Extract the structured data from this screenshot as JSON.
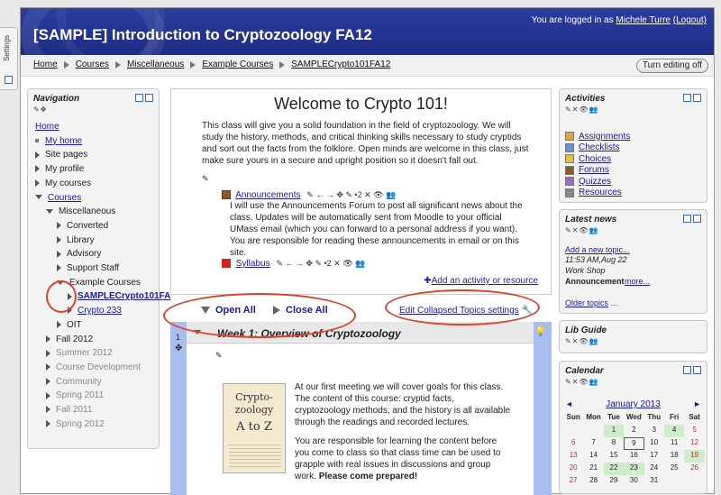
{
  "settings_tab": {
    "label": "Settings"
  },
  "header": {
    "site_title": "[SAMPLE] Introduction to Cryptozoology FA12",
    "login_prefix": "You are logged in as",
    "user_name": "Michele Turre",
    "logout": "(Logout)"
  },
  "breadcrumb": [
    "Home",
    "Courses",
    "Miscellaneous",
    "Example Courses",
    "SAMPLECrypto101FA12"
  ],
  "turn_editing_off": "Turn editing off",
  "navigation": {
    "title": "Navigation",
    "items": [
      {
        "label": "Home",
        "type": "link",
        "depth": 0
      },
      {
        "label": "My home",
        "type": "bullet",
        "depth": 0
      },
      {
        "label": "Site pages",
        "type": "collapsed",
        "depth": 0
      },
      {
        "label": "My profile",
        "type": "collapsed",
        "depth": 0
      },
      {
        "label": "My courses",
        "type": "collapsed",
        "depth": 0
      },
      {
        "label": "Courses",
        "type": "expanded",
        "depth": 0
      },
      {
        "label": "Miscellaneous",
        "type": "expanded",
        "depth": 1
      },
      {
        "label": "Converted",
        "type": "collapsed",
        "depth": 2
      },
      {
        "label": "Library",
        "type": "collapsed",
        "depth": 2
      },
      {
        "label": "Advisory",
        "type": "collapsed",
        "depth": 2
      },
      {
        "label": "Support Staff",
        "type": "collapsed",
        "depth": 2
      },
      {
        "label": "Example Courses",
        "type": "expanded",
        "depth": 2
      },
      {
        "label": "SAMPLECrypto101FA",
        "type": "current",
        "depth": 3
      },
      {
        "label": "Crypto 233",
        "type": "collapsed",
        "depth": 3
      },
      {
        "label": "OIT",
        "type": "collapsed",
        "depth": 2
      },
      {
        "label": "Fall 2012",
        "type": "collapsed",
        "depth": 1
      },
      {
        "label": "Summer 2012",
        "type": "grey",
        "depth": 1
      },
      {
        "label": "Course Development",
        "type": "grey",
        "depth": 1
      },
      {
        "label": "Community",
        "type": "grey",
        "depth": 1
      },
      {
        "label": "Spring 2011",
        "type": "grey",
        "depth": 1
      },
      {
        "label": "Fall 2011",
        "type": "grey",
        "depth": 1
      },
      {
        "label": "Spring 2012",
        "type": "grey",
        "depth": 1
      }
    ]
  },
  "welcome": {
    "heading": "Welcome to Crypto 101!",
    "intro": "This class will give you a solid foundation in the field of cryptozoology. We will study the history, methods, and critical thinking skills necessary to study cryptids and sort out the facts from the folklore. Open minds are welcome in this class, just make sure yours in a secure and upright position so it doesn't fall out.",
    "announcements": "Announcements",
    "announcements_desc": "I will use the Announcements Forum to post all significant news about the class. Updates will be automatically sent from Moodle to your official UMass email (which you can forward to a personal address if you want). You are responsible for reading these announcements in email or on this site.",
    "syllabus": "Syllabus",
    "add_activity": "Add an activity or resource"
  },
  "controls": {
    "open_all": "Open All",
    "close_all": "Close All",
    "edit_collapsed": "Edit Collapsed Topics settings"
  },
  "week1": {
    "number": "1",
    "title": "Week 1: Overview of Cryptozoology",
    "p1": "At our first meeting we will cover goals for this class. The content of this course: cryptid facts, cryptozoology methods, and the history is all available through the readings and recorded lectures.",
    "p2": "You are responsible for learning the content before you come to class so that class time can be used to grapple with real issues in discussions and group work.",
    "p2_bold": "Please come prepared!",
    "book_line1": "Crypto-",
    "book_line2": "zoology",
    "book_line3": "A to Z"
  },
  "activities": {
    "title": "Activities",
    "items": [
      "Assignments",
      "Checklists",
      "Choices",
      "Forums",
      "Quizzes",
      "Resources"
    ],
    "icon_colors": [
      "#d9a441",
      "#6b8fd6",
      "#e0c040",
      "#8a5a2a",
      "#9a6cc2",
      "#888888"
    ]
  },
  "latest_news": {
    "title": "Latest news",
    "add_topic": "Add a new topic...",
    "time": "11:53 AM,Aug 22",
    "author": "Work Shop",
    "subject": "Announcement",
    "more": "more...",
    "older": "Older topics"
  },
  "lib_guide": {
    "title": "Lib Guide"
  },
  "calendar": {
    "title": "Calendar",
    "month": "January 2013",
    "prev": "◄",
    "next": "►",
    "day_headers": [
      "Sun",
      "Mon",
      "Tue",
      "Wed",
      "Thu",
      "Fri",
      "Sat"
    ],
    "weeks": [
      [
        "",
        "",
        "1",
        "2",
        "3",
        "4",
        "5"
      ],
      [
        "6",
        "7",
        "8",
        "9",
        "10",
        "11",
        "12"
      ],
      [
        "13",
        "14",
        "15",
        "16",
        "17",
        "18",
        "19"
      ],
      [
        "20",
        "21",
        "22",
        "23",
        "24",
        "25",
        "26"
      ],
      [
        "27",
        "28",
        "29",
        "30",
        "31",
        "",
        ""
      ]
    ],
    "event_days": [
      "1",
      "4",
      "19",
      "22",
      "23"
    ],
    "today": "9"
  },
  "accent_colors": {
    "header": "#1d2c85",
    "link": "#1a1aa6",
    "section_bg": "#a9bdf0",
    "highlight_oval": "#e0412a"
  }
}
